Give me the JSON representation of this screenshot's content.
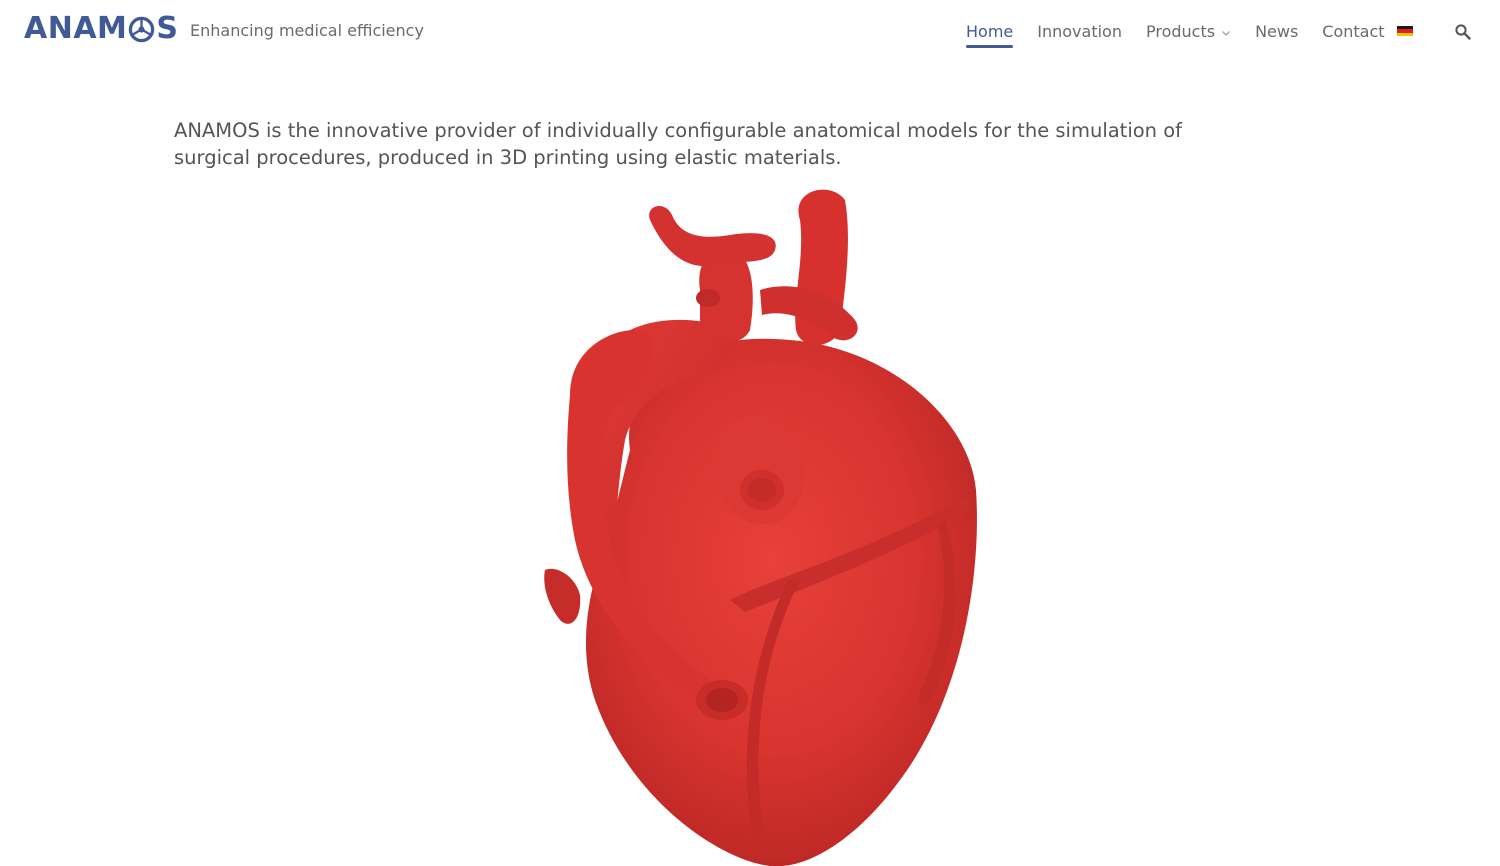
{
  "header": {
    "logo_text_left": "ANAM",
    "logo_text_right": "S",
    "tagline": "Enhancing medical efficiency"
  },
  "nav": {
    "items": [
      {
        "label": "Home",
        "active": true
      },
      {
        "label": "Innovation",
        "active": false
      },
      {
        "label": "Products",
        "active": false,
        "has_dropdown": true
      },
      {
        "label": "News",
        "active": false
      },
      {
        "label": "Contact",
        "active": false
      }
    ],
    "language_icon": "german-flag-icon",
    "search_icon": "search-icon"
  },
  "main": {
    "intro": "ANAMOS is the innovative provider of individually configurable anatomical models for the simulation of surgical procedures, produced in 3D printing using elastic materials.",
    "hero_image": "3d-printed-heart-model"
  },
  "colors": {
    "brand": "#3f5a96",
    "text": "#555555",
    "nav_text": "#6a6a6a",
    "heart": "#e0312f"
  }
}
